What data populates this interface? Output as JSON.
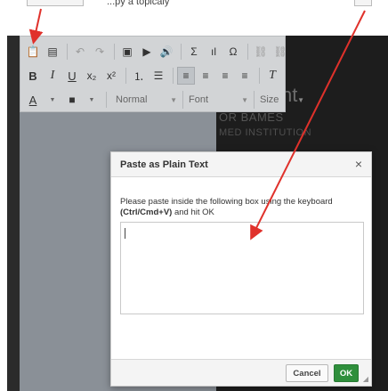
{
  "top_caption": "...py a topicaly",
  "background": {
    "heading": "nt",
    "line1": "OR BAMES",
    "line2": "MED INSTITUTION"
  },
  "toolbar": {
    "row1": [
      {
        "name": "paste-text-icon",
        "glyph": "📋"
      },
      {
        "name": "paste-word-icon",
        "glyph": "▤"
      },
      {
        "name": "undo-icon",
        "glyph": "↶"
      },
      {
        "name": "redo-icon",
        "glyph": "↷"
      },
      {
        "name": "image-icon",
        "glyph": "▣"
      },
      {
        "name": "video-icon",
        "glyph": "▶"
      },
      {
        "name": "audio-icon",
        "glyph": "🔊"
      },
      {
        "name": "sigma-icon",
        "glyph": "Σ"
      },
      {
        "name": "chart-icon",
        "glyph": "ıl"
      },
      {
        "name": "omega-icon",
        "glyph": "Ω"
      },
      {
        "name": "link-icon",
        "glyph": "⛓"
      },
      {
        "name": "unlink-icon",
        "glyph": "⛓"
      }
    ],
    "row2": [
      {
        "name": "bold-icon",
        "glyph": "B"
      },
      {
        "name": "italic-icon",
        "glyph": "I"
      },
      {
        "name": "underline-icon",
        "glyph": "U"
      },
      {
        "name": "subscript-icon",
        "glyph": "x₂"
      },
      {
        "name": "superscript-icon",
        "glyph": "x²"
      },
      {
        "name": "numbered-list-icon",
        "glyph": "⒈"
      },
      {
        "name": "bulleted-list-icon",
        "glyph": "☰"
      },
      {
        "name": "align-left-icon",
        "glyph": "≡"
      },
      {
        "name": "align-center-icon",
        "glyph": "≡"
      },
      {
        "name": "align-right-icon",
        "glyph": "≡"
      },
      {
        "name": "justify-icon",
        "glyph": "≡"
      },
      {
        "name": "clear-format-icon",
        "glyph": "T"
      }
    ],
    "row3": {
      "text_color": "A",
      "bg_color": "■",
      "format_label": "Normal",
      "font_label": "Font",
      "size_label": "Size",
      "dropdown_arrow": "▼"
    }
  },
  "dialog": {
    "title": "Paste as Plain Text",
    "close": "×",
    "instruction_pre": "Please paste inside the following box using the keyboard ",
    "instruction_keys": "(Ctrl/Cmd+V)",
    "instruction_post": " and hit OK",
    "textarea_value": "",
    "cancel_label": "Cancel",
    "ok_label": "OK",
    "resize": "◢"
  },
  "colors": {
    "ok_button": "#2f8f3c",
    "annotation_arrow": "#e0312b"
  }
}
